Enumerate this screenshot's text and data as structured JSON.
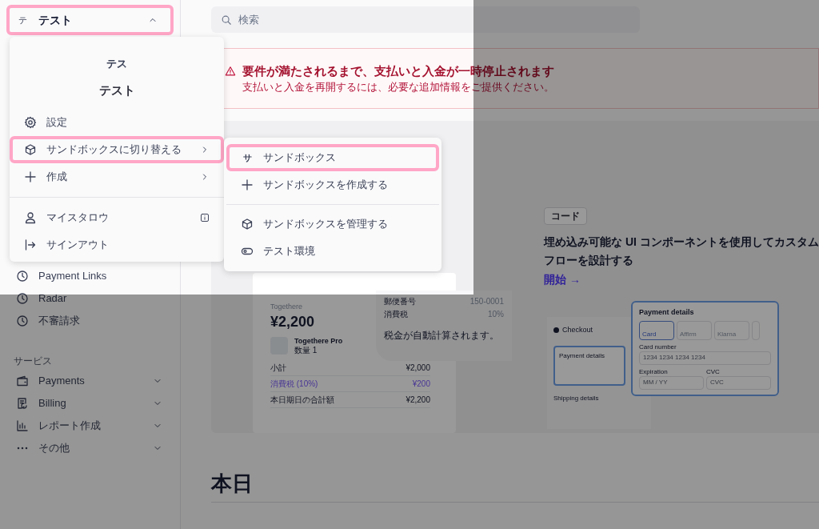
{
  "account_button": {
    "avatar": "テ",
    "label": "テスト",
    "expanded": true,
    "highlighted": true
  },
  "search": {
    "placeholder": "検索"
  },
  "sidebar": {
    "items": [
      {
        "label": "Payment Links"
      },
      {
        "label": "Radar"
      },
      {
        "label": "不審請求"
      }
    ],
    "section": {
      "title": "サービス",
      "items": [
        {
          "label": "Payments",
          "expanded": false
        },
        {
          "label": "Billing",
          "expanded": false
        },
        {
          "label": "レポート作成",
          "expanded": false
        },
        {
          "label": "その他",
          "expanded": false
        }
      ]
    }
  },
  "banner": {
    "title": "要件が満たされるまで、支払いと入金が一時停止されます",
    "message": "支払いと入金を再開するには、必要な追加情報をご提供ください。"
  },
  "feature_card": {
    "tag": "コード",
    "heading": "埋め込み可能な UI コンポーネントを使用してカスタムフローを設計する",
    "link": "開始 →"
  },
  "receipt_preview": {
    "merchant": "Togethere",
    "amount": "¥2,200",
    "product": "Togethere Pro",
    "quantity": "数量 1",
    "rows": [
      {
        "label": "小計",
        "value": "¥2,000",
        "accent": false
      },
      {
        "label": "消費税 (10%)",
        "value": "¥200",
        "accent": true
      },
      {
        "label": "本日期日の合計額",
        "value": "¥2,200",
        "accent": false
      }
    ],
    "address_rows": [
      {
        "label": "郵便番号",
        "value": "150-0001"
      },
      {
        "label": "消費税",
        "value": "10%"
      }
    ],
    "note": "税金が自動計算されます。"
  },
  "checkout_preview": {
    "title": "Checkout",
    "section": "Payment details",
    "shipping": "Shipping details",
    "panel_title": "Payment details",
    "methods": [
      {
        "label": "Card",
        "selected": true
      },
      {
        "label": "Affirm",
        "selected": false
      },
      {
        "label": "Klarna",
        "selected": false
      }
    ],
    "card_number_label": "Card number",
    "card_number_placeholder": "1234 1234 1234 1234",
    "expiration_label": "Expiration",
    "expiration_placeholder": "MM / YY",
    "cvc_label": "CVC",
    "cvc_placeholder": "CVC"
  },
  "section_heading": "本日",
  "account_menu": {
    "avatar": "テス",
    "name": "テスト",
    "groups": [
      [
        {
          "label": "設定",
          "has_submenu": false,
          "highlighted": false
        },
        {
          "label": "サンドボックスに切り替える",
          "has_submenu": true,
          "highlighted": true
        },
        {
          "label": "作成",
          "has_submenu": true,
          "highlighted": false
        }
      ],
      [
        {
          "label": "マイスタロウ",
          "has_submenu": false,
          "highlighted": false
        },
        {
          "label": "サインアウト",
          "has_submenu": false,
          "highlighted": false
        }
      ]
    ]
  },
  "sandbox_menu": {
    "groups": [
      [
        {
          "label": "サンドボックス",
          "badge": "サ",
          "highlighted": true
        },
        {
          "label": "サンドボックスを作成する",
          "highlighted": false
        }
      ],
      [
        {
          "label": "サンドボックスを管理する",
          "highlighted": false
        },
        {
          "label": "テスト環境",
          "highlighted": false
        }
      ]
    ]
  }
}
